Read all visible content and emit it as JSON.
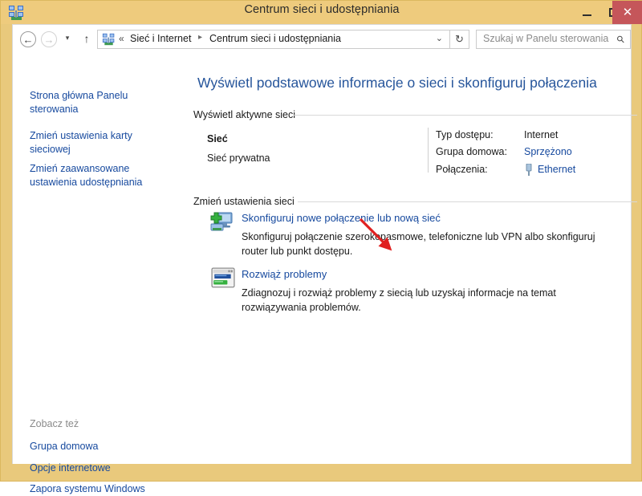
{
  "window": {
    "title": "Centrum sieci i udostępniania",
    "title_icon": "network-icon",
    "minimize_label": "–",
    "maximize_label": "",
    "close_label": "✕",
    "titlebar_color": "#eecb7d",
    "close_color": "#c5565a",
    "border_color": "#dcb85f"
  },
  "navbar": {
    "back_glyph": "←",
    "forward_glyph": "→",
    "recent_glyph": "▾",
    "up_glyph": "↑",
    "breadcrumb_icon": "network-icon",
    "breadcrumb_prefix": "«",
    "breadcrumb_root": "Sieć i Internet",
    "breadcrumb_separator": "▸",
    "breadcrumb_leaf": "Centrum sieci i udostępniania",
    "dropdown_glyph": "⌄",
    "refresh_glyph": "↻",
    "search_placeholder": "Szukaj w Panelu sterowania",
    "search_value": "",
    "search_icon": "⚲"
  },
  "sidebar": {
    "links": [
      "Strona główna Panelu sterowania",
      "Zmień ustawienia karty sieciowej",
      "Zmień zaawansowane ustawienia udostępniania"
    ],
    "see_also_heading": "Zobacz też",
    "see_also": [
      "Grupa domowa",
      "Opcje internetowe",
      "Zapora systemu Windows"
    ]
  },
  "content": {
    "page_title": "Wyświetl podstawowe informacje o sieci i skonfiguruj połączenia",
    "active_networks_heading": "Wyświetl aktywne sieci",
    "change_settings_heading": "Zmień ustawienia sieci",
    "network": {
      "name": "Sieć",
      "type": "Sieć prywatna",
      "details": [
        {
          "label": "Typ dostępu:",
          "value": "Internet",
          "is_link": false
        },
        {
          "label": "Grupa domowa:",
          "value": "Sprzężono",
          "is_link": true
        },
        {
          "label": "Połączenia:",
          "value": "Ethernet",
          "is_link": true,
          "icon": "network-plug-icon"
        }
      ]
    },
    "tasks": [
      {
        "icon": "add-network-icon",
        "link": "Skonfiguruj nowe połączenie lub nową sieć",
        "description": "Skonfiguruj połączenie szerokopasmowe, telefoniczne lub VPN albo skonfiguruj router lub punkt dostępu."
      },
      {
        "icon": "troubleshoot-icon",
        "link": "Rozwiąż problemy",
        "description": "Zdiagnozuj i rozwiąż problemy z siecią lub uzyskaj informacje na temat rozwiązywania problemów."
      }
    ]
  },
  "annotation": {
    "type": "red-arrow",
    "color": "#e02020",
    "points_to": "add-network-icon"
  },
  "colors": {
    "link": "#16499e",
    "title_blue": "#26559b",
    "text": "#1a1a1a",
    "muted": "#8a8a8a"
  }
}
